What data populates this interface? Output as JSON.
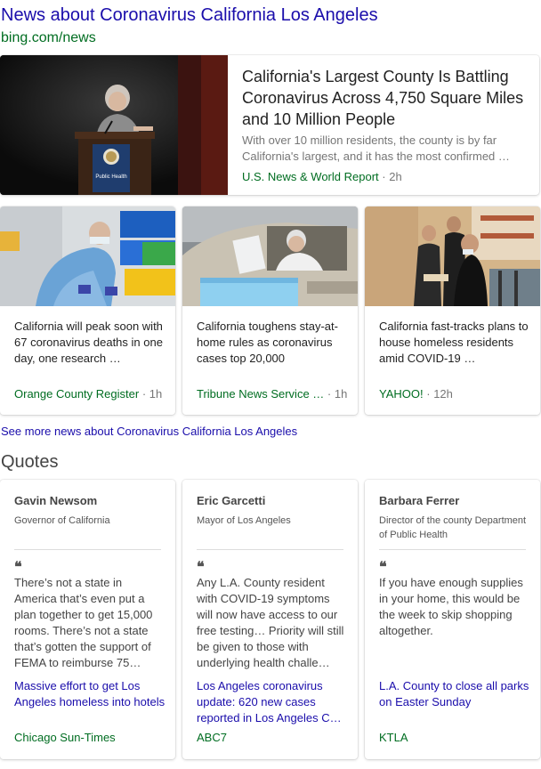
{
  "header": {
    "title": "News about Coronavirus California Los Angeles",
    "url": "bing.com/news"
  },
  "top_story": {
    "headline": "California's Largest County Is Battling Coronavirus Across 4,750 Square Miles and 10 Million People",
    "snippet": "With over 10 million residents, the county is by far California's largest, and it has the most confirmed …",
    "source": "U.S. News & World Report",
    "time": "2h",
    "podium_text": "Public Health"
  },
  "news_cards": [
    {
      "title": "California will peak soon with 67 coronavirus deaths in one day, one research …",
      "source": "Orange County Register",
      "time": "1h"
    },
    {
      "title": "California toughens stay-at-home rules as coronavirus cases top 20,000",
      "source": "Tribune News Service …",
      "time": "1h"
    },
    {
      "title": "California fast-tracks plans to house homeless residents amid COVID-19 …",
      "source": "YAHOO!",
      "time": "12h"
    }
  ],
  "see_more": "See more news about Coronavirus California Los Angeles",
  "quotes_heading": "Quotes",
  "quotes": [
    {
      "name": "Gavin Newsom",
      "role": "Governor of California",
      "quote": "There’s not a state in America that’s even put a plan together to get 15,000 rooms. There’s not a state that’s gotten the support of FEMA to reimburse 75…",
      "link": "Massive effort to get Los Angeles homeless into hotels",
      "source": "Chicago Sun-Times"
    },
    {
      "name": "Eric Garcetti",
      "role": "Mayor of Los Angeles",
      "quote": "Any L.A. County resident with COVID-19 symptoms will now have access to our free testing… Priority will still be given to those with underlying health challe…",
      "link": "Los Angeles coronavirus update: 620 new cases reported in Los Angeles C…",
      "source": "ABC7"
    },
    {
      "name": "Barbara Ferrer",
      "role": "Director of the county Department of Public Health",
      "quote": "If you have enough supplies in your home, this would be the week to skip shopping altogether.",
      "link": "L.A. County to close all parks on Easter Sunday",
      "source": "KTLA"
    }
  ],
  "quote_mark": "❝",
  "separator": "·",
  "colors": {
    "link": "#1a0dab",
    "source": "#006d21",
    "meta": "#767676"
  }
}
